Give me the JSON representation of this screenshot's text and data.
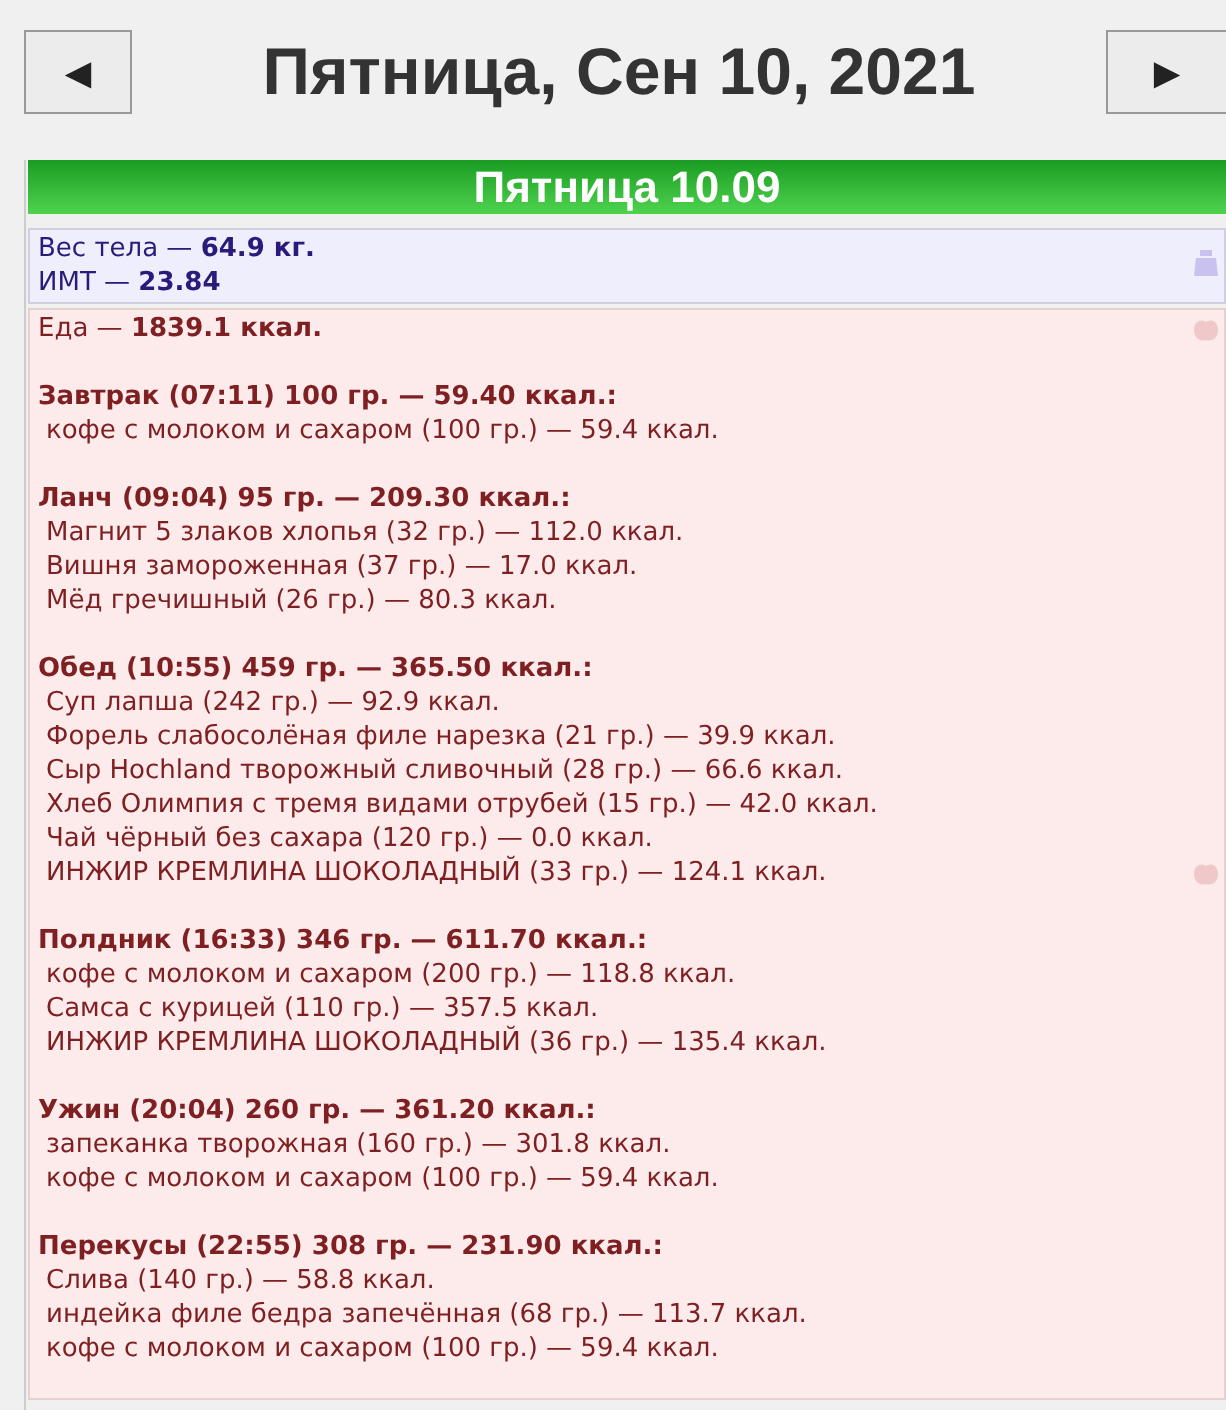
{
  "header": {
    "prev_button": "◄",
    "title": "Пятница, Сен 10, 2021",
    "next_button": "►"
  },
  "day_bar": "Пятница 10.09",
  "body_stats": [
    "Вес тела — **64.9 кг.**",
    "ИМТ — **23.84**"
  ],
  "food_total": "Еда — **1839.1 ккал.**",
  "meals": [
    {
      "title": "Завтрак (07:11) 100 гр. — 59.40 ккал.:",
      "items": [
        "кофе с молоком и сахаром (100 гр.) — 59.4 ккал."
      ]
    },
    {
      "title": "Ланч (09:04) 95 гр. — 209.30 ккал.:",
      "items": [
        "Магнит 5 злаков хлопья (32 гр.) — 112.0 ккал.",
        "Вишня замороженная (37 гр.) — 17.0 ккал.",
        "Мёд гречишный (26 гр.) — 80.3 ккал."
      ]
    },
    {
      "title": "Обед (10:55) 459 гр. — 365.50 ккал.:",
      "items": [
        "Суп лапша (242 гр.) — 92.9 ккал.",
        "Форель слабосолёная филе нарезка (21 гр.) — 39.9 ккал.",
        "Сыр Hochland творожный сливочный (28 гр.) — 66.6 ккал.",
        "Хлеб Олимпия с тремя видами отрубей (15 гр.) — 42.0 ккал.",
        "Чай чёрный без сахара (120 гр.) — 0.0 ккал.",
        "ИНЖИР КРЕМЛИНА ШОКОЛАДНЫЙ (33 гр.) — 124.1 ккал."
      ]
    },
    {
      "title": "Полдник (16:33) 346 гр. — 611.70 ккал.:",
      "items": [
        "кофе с молоком и сахаром (200 гр.) — 118.8 ккал.",
        "Самса с курицей (110 гр.) — 357.5 ккал.",
        "ИНЖИР КРЕМЛИНА ШОКОЛАДНЫЙ (36 гр.) — 135.4 ккал."
      ]
    },
    {
      "title": "Ужин (20:04) 260 гр. — 361.20 ккал.:",
      "items": [
        "запеканка творожная (160 гр.) — 301.8 ккал.",
        "кофе с молоком и сахаром (100 гр.) — 59.4 ккал."
      ]
    },
    {
      "title": "Перекусы (22:55) 308 гр. — 231.90 ккал.:",
      "items": [
        "Слива (140 гр.) — 58.8 ккал.",
        "индейка филе бедра запечённая (68 гр.) — 113.7 ккал.",
        "кофе с молоком и сахаром (100 гр.) — 59.4 ккал."
      ]
    }
  ]
}
